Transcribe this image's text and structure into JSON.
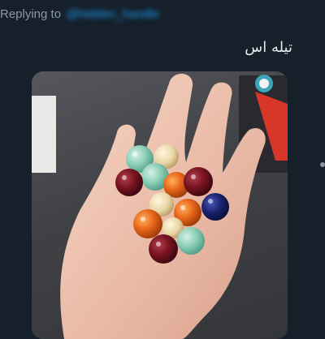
{
  "reply": {
    "prefix": "Replying to",
    "handle": "@hidden_handle"
  },
  "tweet": {
    "text": "تیله اس"
  },
  "media": {
    "icons": [
      "hand-photo",
      "marble"
    ]
  },
  "colors": {
    "background": "#15202b",
    "muted_text": "#8b98a5",
    "link": "#1d9bf0",
    "body_text": "#e7e9ea"
  }
}
